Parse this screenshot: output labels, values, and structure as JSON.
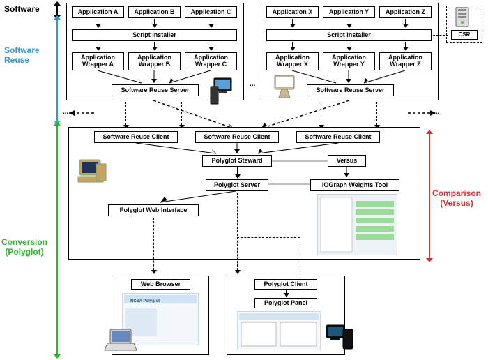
{
  "labels": {
    "software": "Software",
    "software_reuse": "Software\nReuse",
    "conversion": "Conversion\n(Polyglot)",
    "comparison": "Comparison\n(Versus)"
  },
  "colors": {
    "software": "#000000",
    "reuse": "#2E9BD6",
    "conversion": "#2EB82E",
    "comparison": "#D93030"
  },
  "top_left": {
    "apps": [
      "Application A",
      "Application B",
      "Application C"
    ],
    "installer": "Script Installer",
    "wrappers": [
      "Application Wrapper A",
      "Application Wrapper B",
      "Application Wrapper C"
    ],
    "server": "Software Reuse Server"
  },
  "top_right": {
    "apps": [
      "Application X",
      "Application Y",
      "Application Z"
    ],
    "installer": "Script Installer",
    "wrappers": [
      "Application Wrapper X",
      "Application Wrapper Y",
      "Application Wrapper Z"
    ],
    "server": "Software Reuse Server"
  },
  "csr": "CSR",
  "middle": {
    "clients": [
      "Software Reuse Client",
      "Software Reuse Client",
      "Software Reuse Client"
    ],
    "steward": "Polyglot Steward",
    "server": "Polyglot Server",
    "web_interface": "Polyglot Web Interface",
    "versus": "Versus",
    "iograph": "IOGraph Weights Tool"
  },
  "bottom": {
    "browser": "Web Browser",
    "client": "Polyglot Client",
    "panel": "Polyglot Panel"
  },
  "ellipsis": "..."
}
